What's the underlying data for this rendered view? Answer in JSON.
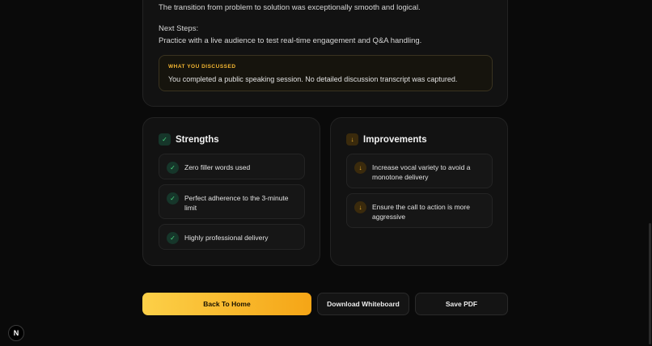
{
  "summary": {
    "transition_line": "The transition from problem to solution was exceptionally smooth and logical.",
    "next_steps_heading": "Next Steps:",
    "next_steps_text": "Practice with a live audience to test real-time engagement and Q&A handling.",
    "discussed_label": "WHAT YOU DISCUSSED",
    "discussed_text": "You completed a public speaking session. No detailed discussion transcript was captured."
  },
  "strengths": {
    "title": "Strengths",
    "items": [
      "Zero filler words used",
      "Perfect adherence to the 3-minute limit",
      "Highly professional delivery"
    ]
  },
  "improvements": {
    "title": "Improvements",
    "items": [
      "Increase vocal variety to avoid a monotone delivery",
      "Ensure the call to action is more aggressive"
    ]
  },
  "actions": {
    "back_home": "Back To Home",
    "download_whiteboard": "Download Whiteboard",
    "save_pdf": "Save PDF"
  },
  "badge": {
    "letter": "N"
  },
  "colors": {
    "accent": "#f5b731",
    "success": "#4ade80",
    "background": "#0a0a0a"
  },
  "icons": {
    "strength": "check-icon",
    "improvement": "arrow-down-icon"
  }
}
